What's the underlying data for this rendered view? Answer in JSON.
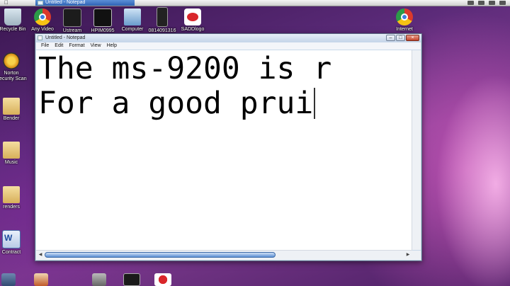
{
  "topbar": {
    "task_title": "Untitled - Notepad"
  },
  "desktop_icons": [
    {
      "label": "Recycle Bin"
    },
    {
      "label": "Any Video"
    },
    {
      "label": "Ustream"
    },
    {
      "label": "HPIM0995"
    },
    {
      "label": "Computer"
    },
    {
      "label": "0814091316"
    },
    {
      "label": "SADDlogo"
    },
    {
      "label": "Internet"
    },
    {
      "label": "Norton Security Scan"
    },
    {
      "label": "Bender"
    },
    {
      "label": "Music"
    },
    {
      "label": "renders"
    },
    {
      "label": "Contract"
    }
  ],
  "window": {
    "title": "Untitled - Notepad",
    "menu": [
      "File",
      "Edit",
      "Format",
      "View",
      "Help"
    ],
    "text_lines": [
      "The ms-9200 is r",
      "For a good prui"
    ]
  },
  "colors": {
    "accent": "#5b8fd3",
    "close": "#c2442a"
  }
}
